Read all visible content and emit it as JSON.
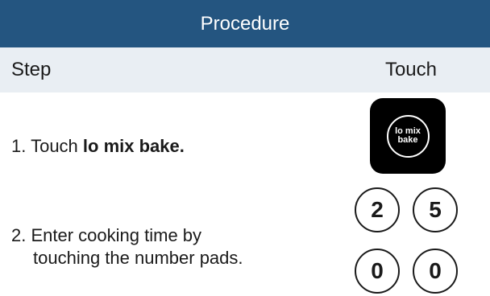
{
  "header": {
    "title": "Procedure"
  },
  "columns": {
    "step": "Step",
    "touch": "Touch"
  },
  "steps": [
    {
      "number": "1.",
      "text_prefix": "Touch ",
      "text_bold": "lo mix bake."
    },
    {
      "number": "2.",
      "line1": "Enter cooking time by",
      "line2": "touching the number pads."
    }
  ],
  "lo_mix_button": {
    "line1": "lo mix",
    "line2": "bake"
  },
  "number_pads": [
    "2",
    "5",
    "0",
    "0"
  ],
  "colors": {
    "header_bg": "#245580",
    "subheader_bg": "#e9eef3",
    "button_bg": "#000000"
  }
}
